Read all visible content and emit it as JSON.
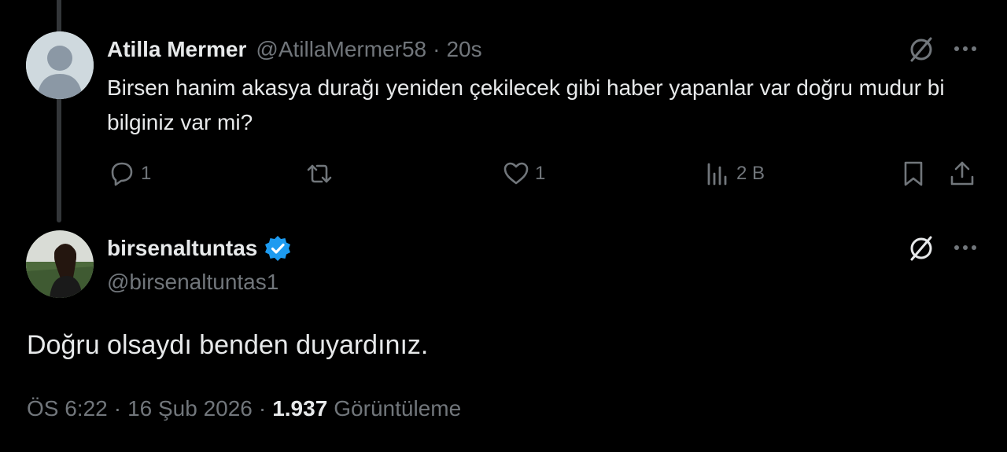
{
  "reply_to_tweet": {
    "author_name": "Atilla Mermer",
    "author_handle": "@AtillaMermer58",
    "separator": "·",
    "time_ago": "20s",
    "text": "Birsen hanim akasya durağı yeniden çekilecek gibi haber yapanlar var doğru mudur bi bilginiz var mi?",
    "actions": {
      "replies": "1",
      "retweets": "",
      "likes": "1",
      "views": "2 B"
    },
    "avatar_icon": "default-avatar-icon"
  },
  "main_tweet": {
    "author_name": "birsenaltuntas",
    "author_handle": "@birsenaltuntas1",
    "verified": true,
    "verified_color": "#1d9bf0",
    "text": "Doğru olsaydı benden duyardınız.",
    "time": "ÖS 6:22",
    "date": "16 Şub 2026",
    "separator": "·",
    "views_count": "1.937",
    "views_label": "Görüntüleme"
  },
  "colors": {
    "background": "#000000",
    "text_primary": "#e7e9ea",
    "text_secondary": "#71767b",
    "thread_line": "#333639"
  }
}
